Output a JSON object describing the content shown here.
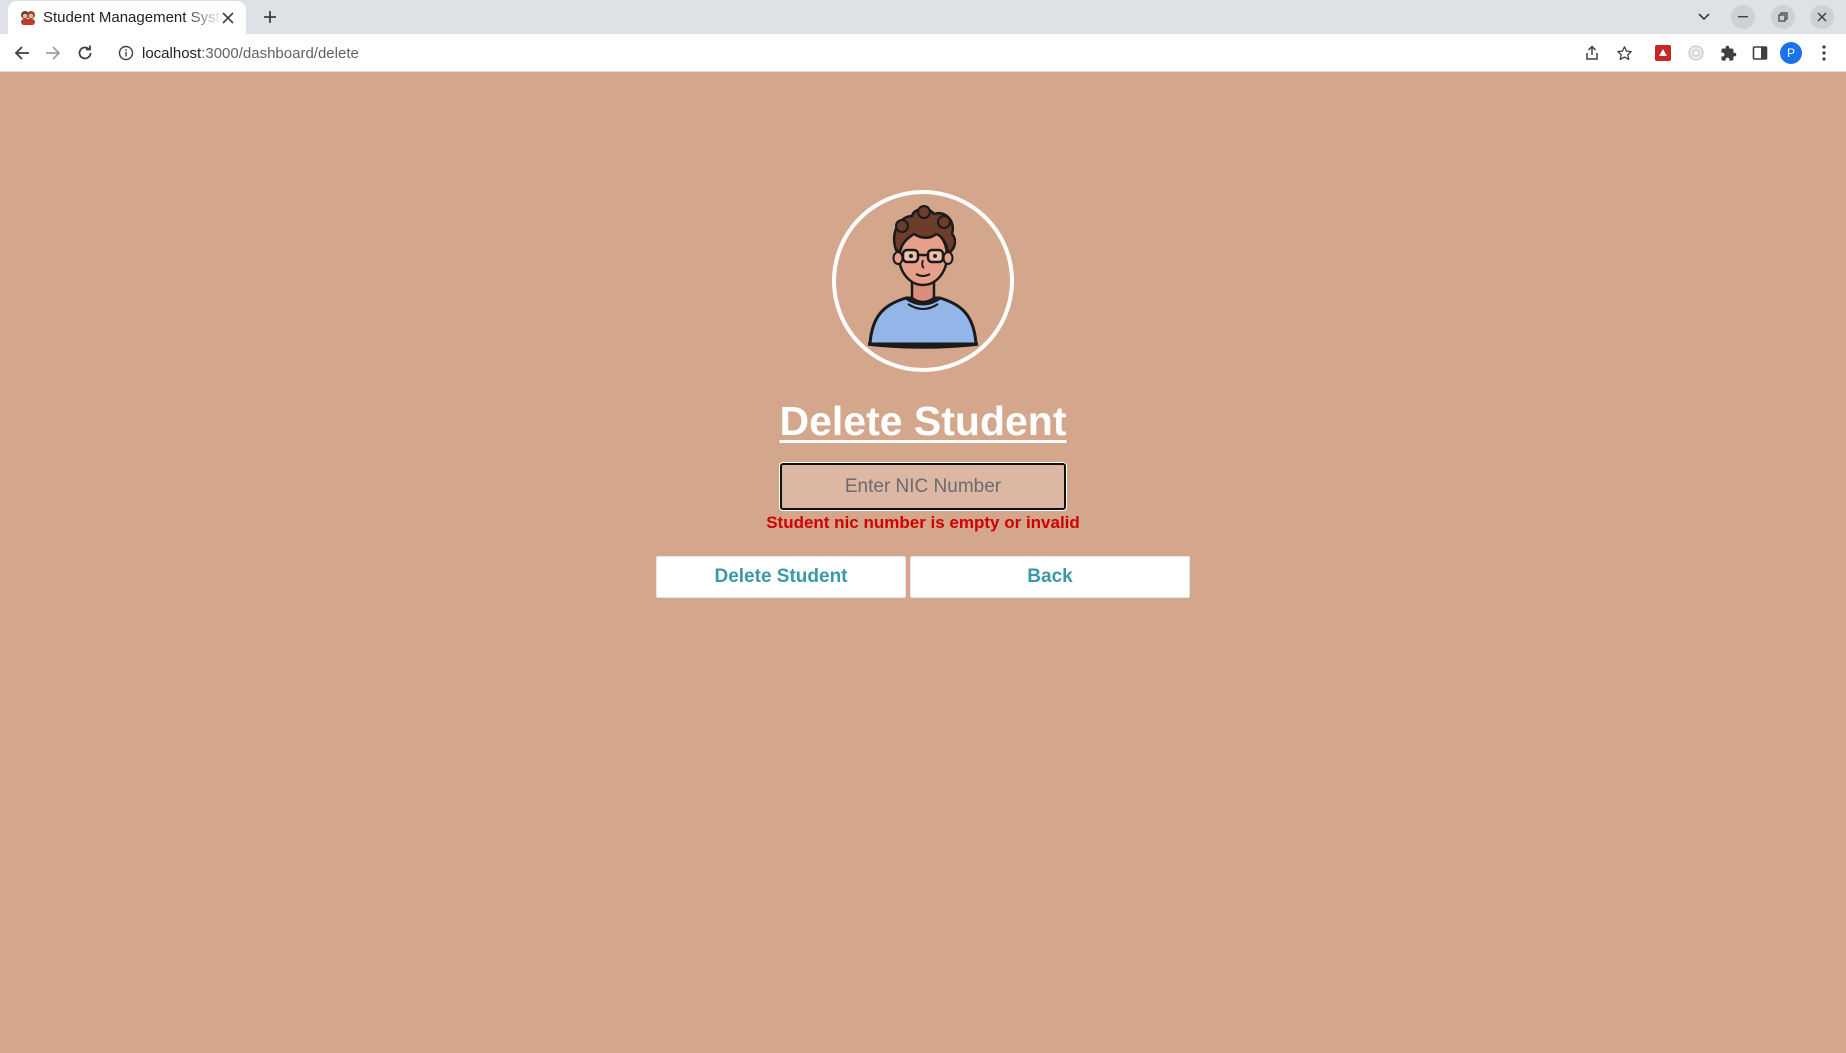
{
  "browser": {
    "tab_title": "Student Management System",
    "url_host": "localhost",
    "url_rest": ":3000/dashboard/delete",
    "profile_initial": "P",
    "icons": {
      "favicon": "students-favicon",
      "close": "close-icon",
      "new_tab": "plus-icon",
      "tab_search": "chevron-down-icon",
      "back": "arrow-left-icon",
      "forward": "arrow-right-icon",
      "reload": "reload-icon",
      "site_info": "info-icon",
      "share": "share-icon",
      "bookmark": "star-icon",
      "extensions": "puzzle-icon",
      "side_panel": "side-panel-icon",
      "menu": "kebab-menu-icon"
    }
  },
  "page": {
    "heading": "Delete Student",
    "nic_input": {
      "placeholder": "Enter NIC Number",
      "value": ""
    },
    "error_message": "Student nic number is empty or invalid",
    "buttons": {
      "delete_label": "Delete Student",
      "back_label": "Back"
    },
    "colors": {
      "background": "#d4a68c",
      "error": "#d00000",
      "button_text": "#3a9aa3",
      "heading": "#ffffff"
    }
  }
}
